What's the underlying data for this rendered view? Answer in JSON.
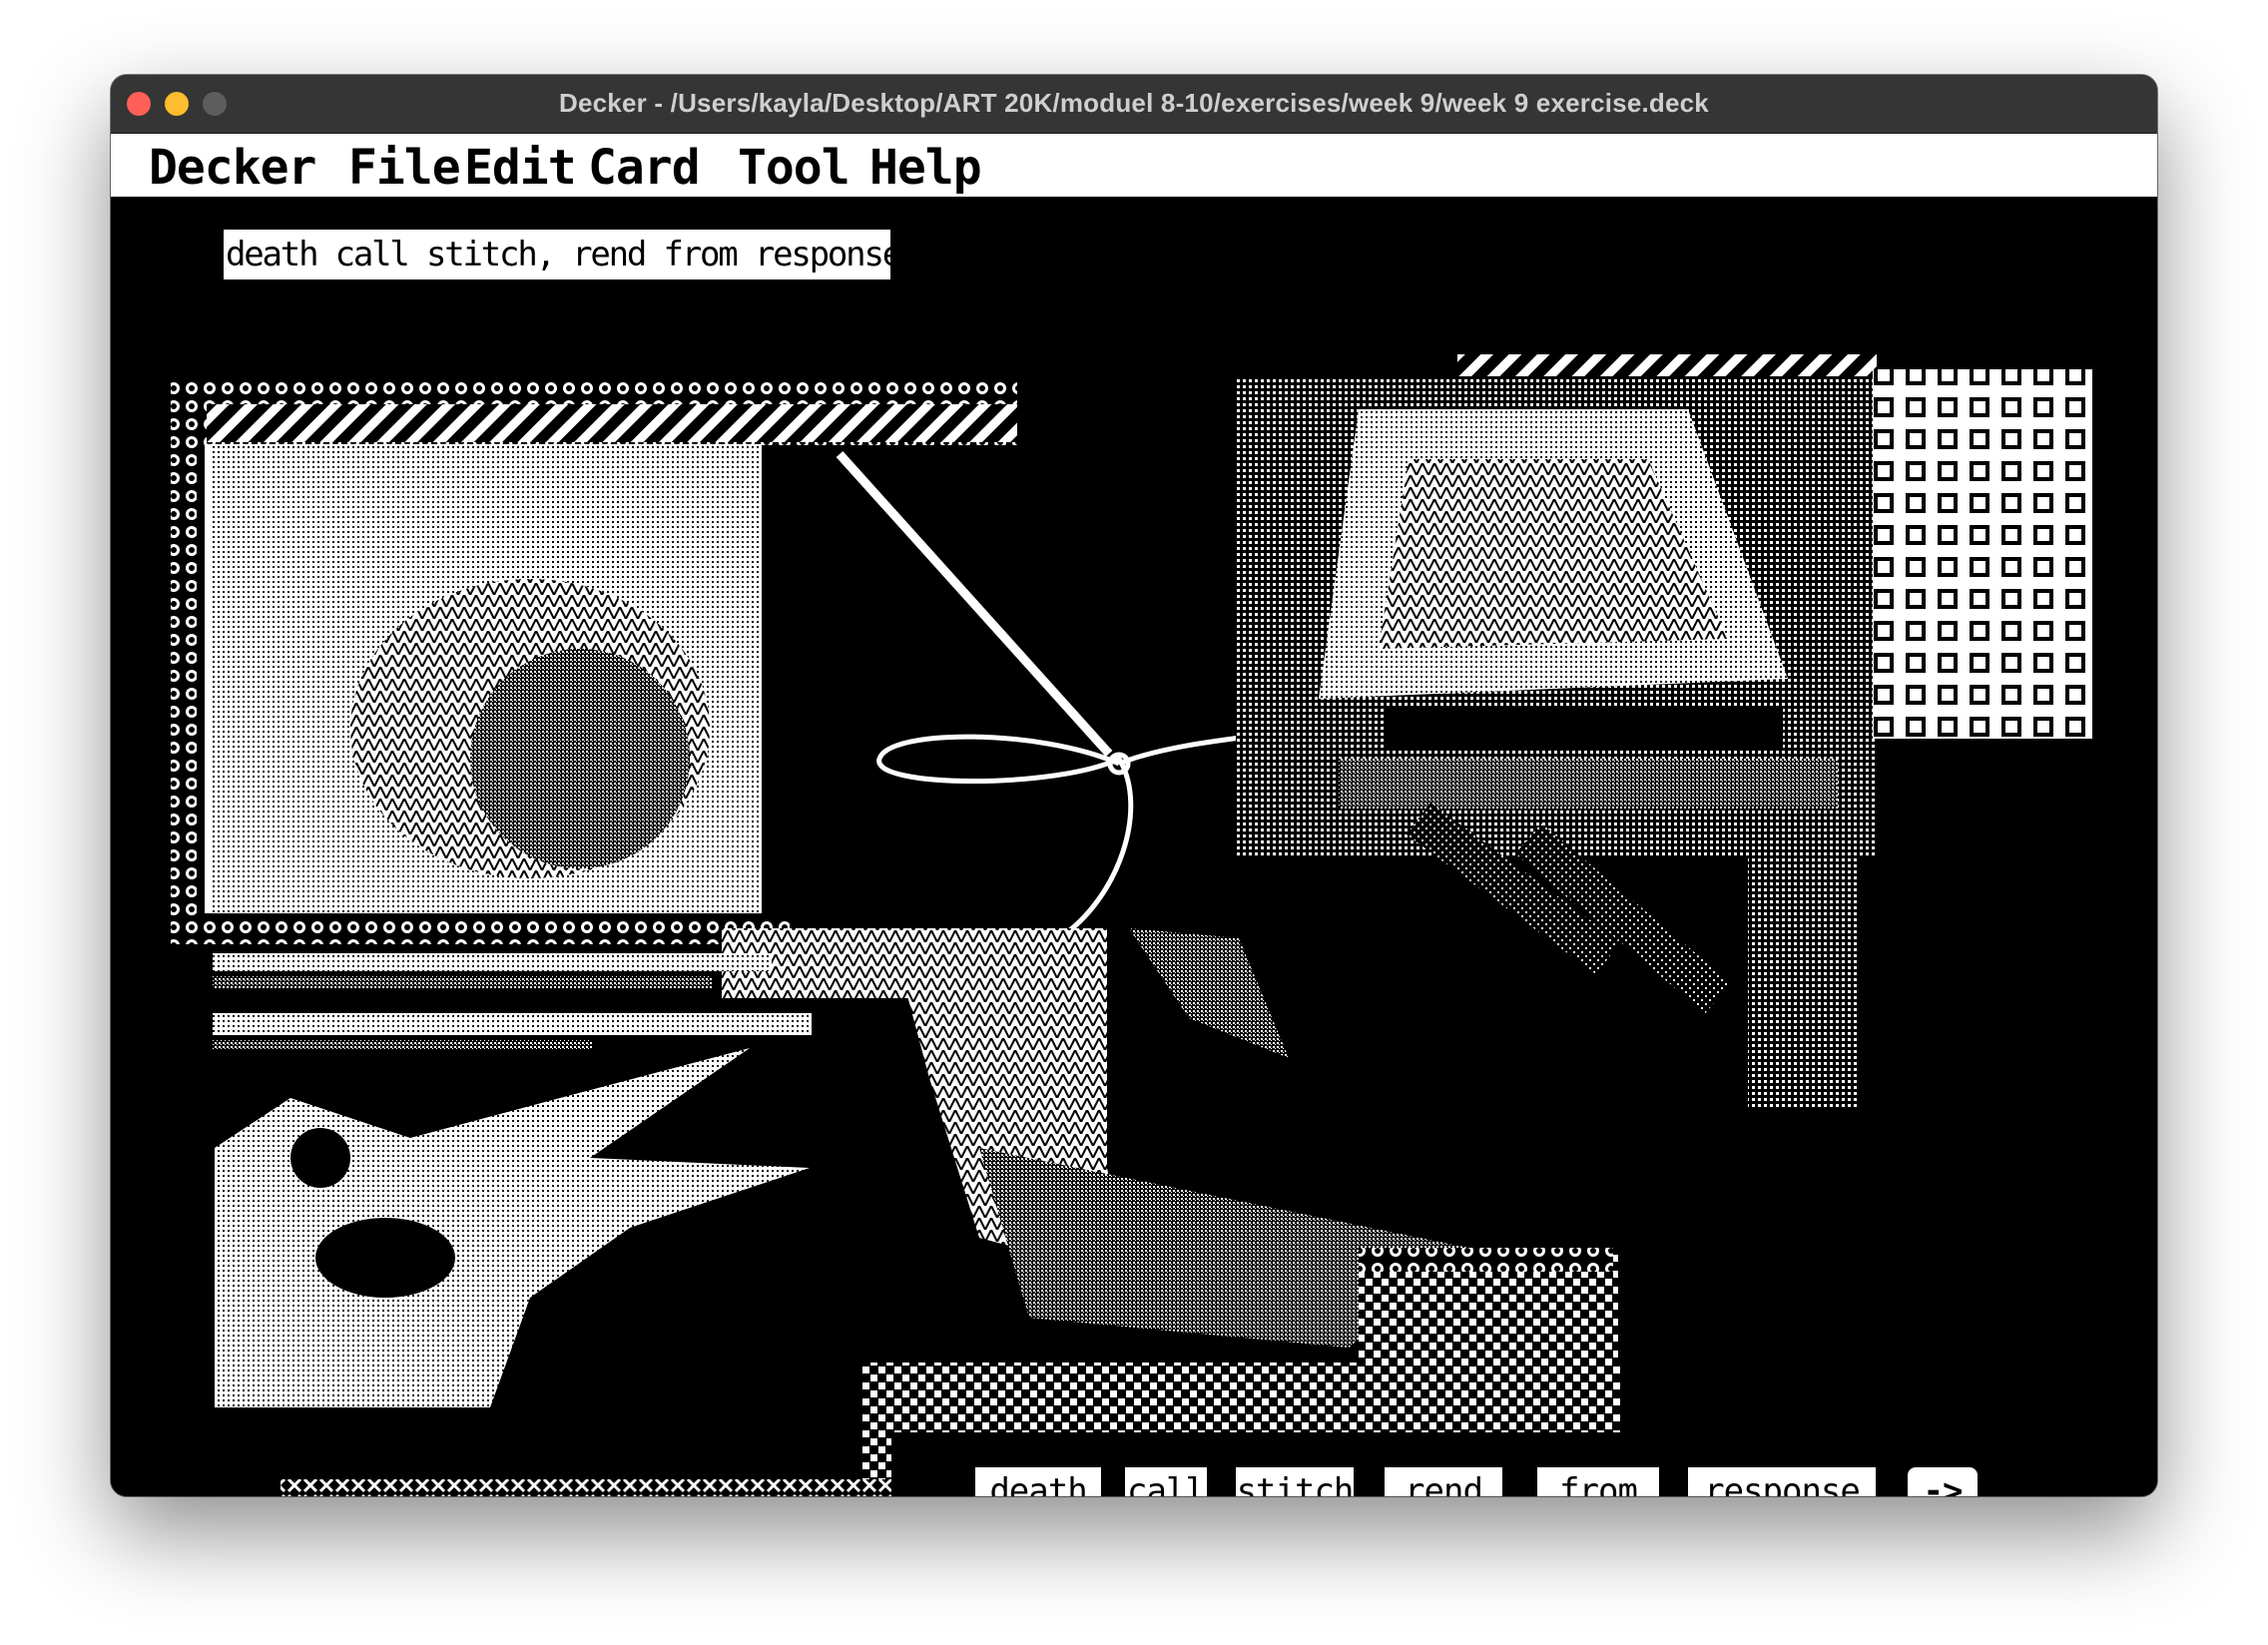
{
  "window": {
    "title": "Decker - /Users/kayla/Desktop/ART 20K/moduel 8-10/exercises/week 9/week 9 exercise.deck"
  },
  "menu": {
    "items": [
      "Decker",
      "File",
      "Edit",
      "Card",
      "Tool",
      "Help"
    ]
  },
  "card": {
    "caption": "death call stitch, rend from response",
    "buttons": [
      "death",
      "call",
      "stitch",
      "rend",
      "from",
      "response"
    ],
    "next_button": "->"
  },
  "icons": {
    "close": "close-traffic-light",
    "minimize": "minimize-traffic-light",
    "zoom": "zoom-traffic-light"
  }
}
